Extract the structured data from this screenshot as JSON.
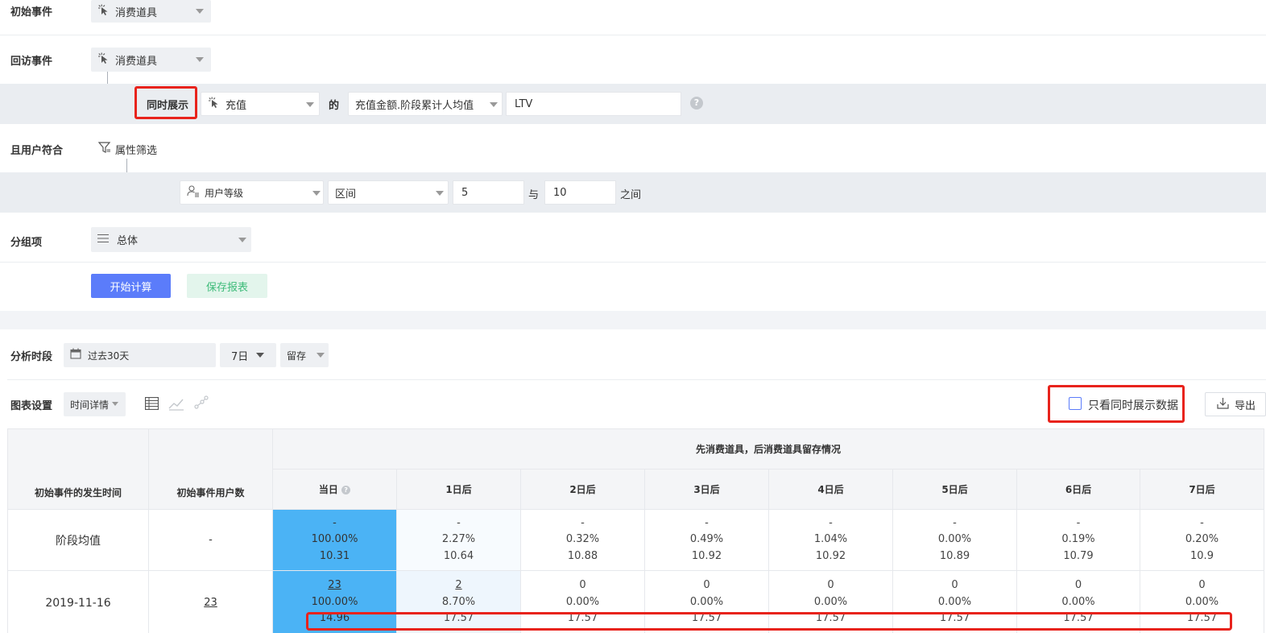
{
  "filters": {
    "initial_event_label": "初始事件",
    "initial_event_value": "消费道具",
    "return_event_label": "回访事件",
    "return_event_value": "消费道具",
    "simultaneous_label": "同时展示",
    "simultaneous_event": "充值",
    "of_label": "的",
    "metric_value": "充值金额.阶段累计人均值",
    "alias_value": "LTV",
    "user_match_label": "且用户符合",
    "attr_filter_label": "属性筛选",
    "attr_field": "用户等级",
    "attr_operator": "区间",
    "range_from": "5",
    "and_label": "与",
    "range_to": "10",
    "between_label": "之间",
    "group_label": "分组项",
    "group_value": "总体",
    "compute_button": "开始计算",
    "save_button": "保存报表"
  },
  "analysis": {
    "period_label": "分析时段",
    "period_value": "过去30天",
    "window_value": "7日",
    "mode_value": "留存",
    "chart_settings_label": "图表设置",
    "chart_view_value": "时间详情",
    "only_simultaneous_label": "只看同时展示数据",
    "only_simultaneous_checked": false,
    "export_label": "导出"
  },
  "table": {
    "col_initial_time": "初始事件的发生时间",
    "col_initial_users": "初始事件用户数",
    "group_header": "先消费道具，后消费道具留存情况",
    "day_headers": [
      "当日",
      "1日后",
      "2日后",
      "3日后",
      "4日后",
      "5日后",
      "6日后",
      "7日后"
    ],
    "rows": [
      {
        "date": "阶段均值",
        "users": "-",
        "cells": [
          [
            "-",
            "100.00%",
            "10.31"
          ],
          [
            "-",
            "2.27%",
            "10.64"
          ],
          [
            "-",
            "0.32%",
            "10.88"
          ],
          [
            "-",
            "0.49%",
            "10.92"
          ],
          [
            "-",
            "1.04%",
            "10.92"
          ],
          [
            "-",
            "0.00%",
            "10.89"
          ],
          [
            "-",
            "0.19%",
            "10.79"
          ],
          [
            "-",
            "0.20%",
            "10.9"
          ]
        ]
      },
      {
        "date": "2019-11-16",
        "users": "23",
        "cells": [
          [
            "23",
            "100.00%",
            "14.96"
          ],
          [
            "2",
            "8.70%",
            "17.57"
          ],
          [
            "0",
            "0.00%",
            "17.57"
          ],
          [
            "0",
            "0.00%",
            "17.57"
          ],
          [
            "0",
            "0.00%",
            "17.57"
          ],
          [
            "0",
            "0.00%",
            "17.57"
          ],
          [
            "0",
            "0.00%",
            "17.57"
          ],
          [
            "0",
            "0.00%",
            "17.57"
          ]
        ]
      }
    ]
  },
  "colors": {
    "highlight_red": "#e8231c",
    "primary_button": "#5b7cfa",
    "save_button_bg": "#e3f5ec",
    "save_button_text": "#3dbb79",
    "today_cell_blue": "#4bb3f5"
  },
  "icons": [
    "cursor-click-icon",
    "funnel-icon",
    "user-list-icon",
    "list-icon",
    "calendar-icon",
    "help-icon",
    "table-view-icon",
    "line-chart-icon",
    "scatter-chart-icon",
    "download-icon",
    "checkbox-icon"
  ]
}
